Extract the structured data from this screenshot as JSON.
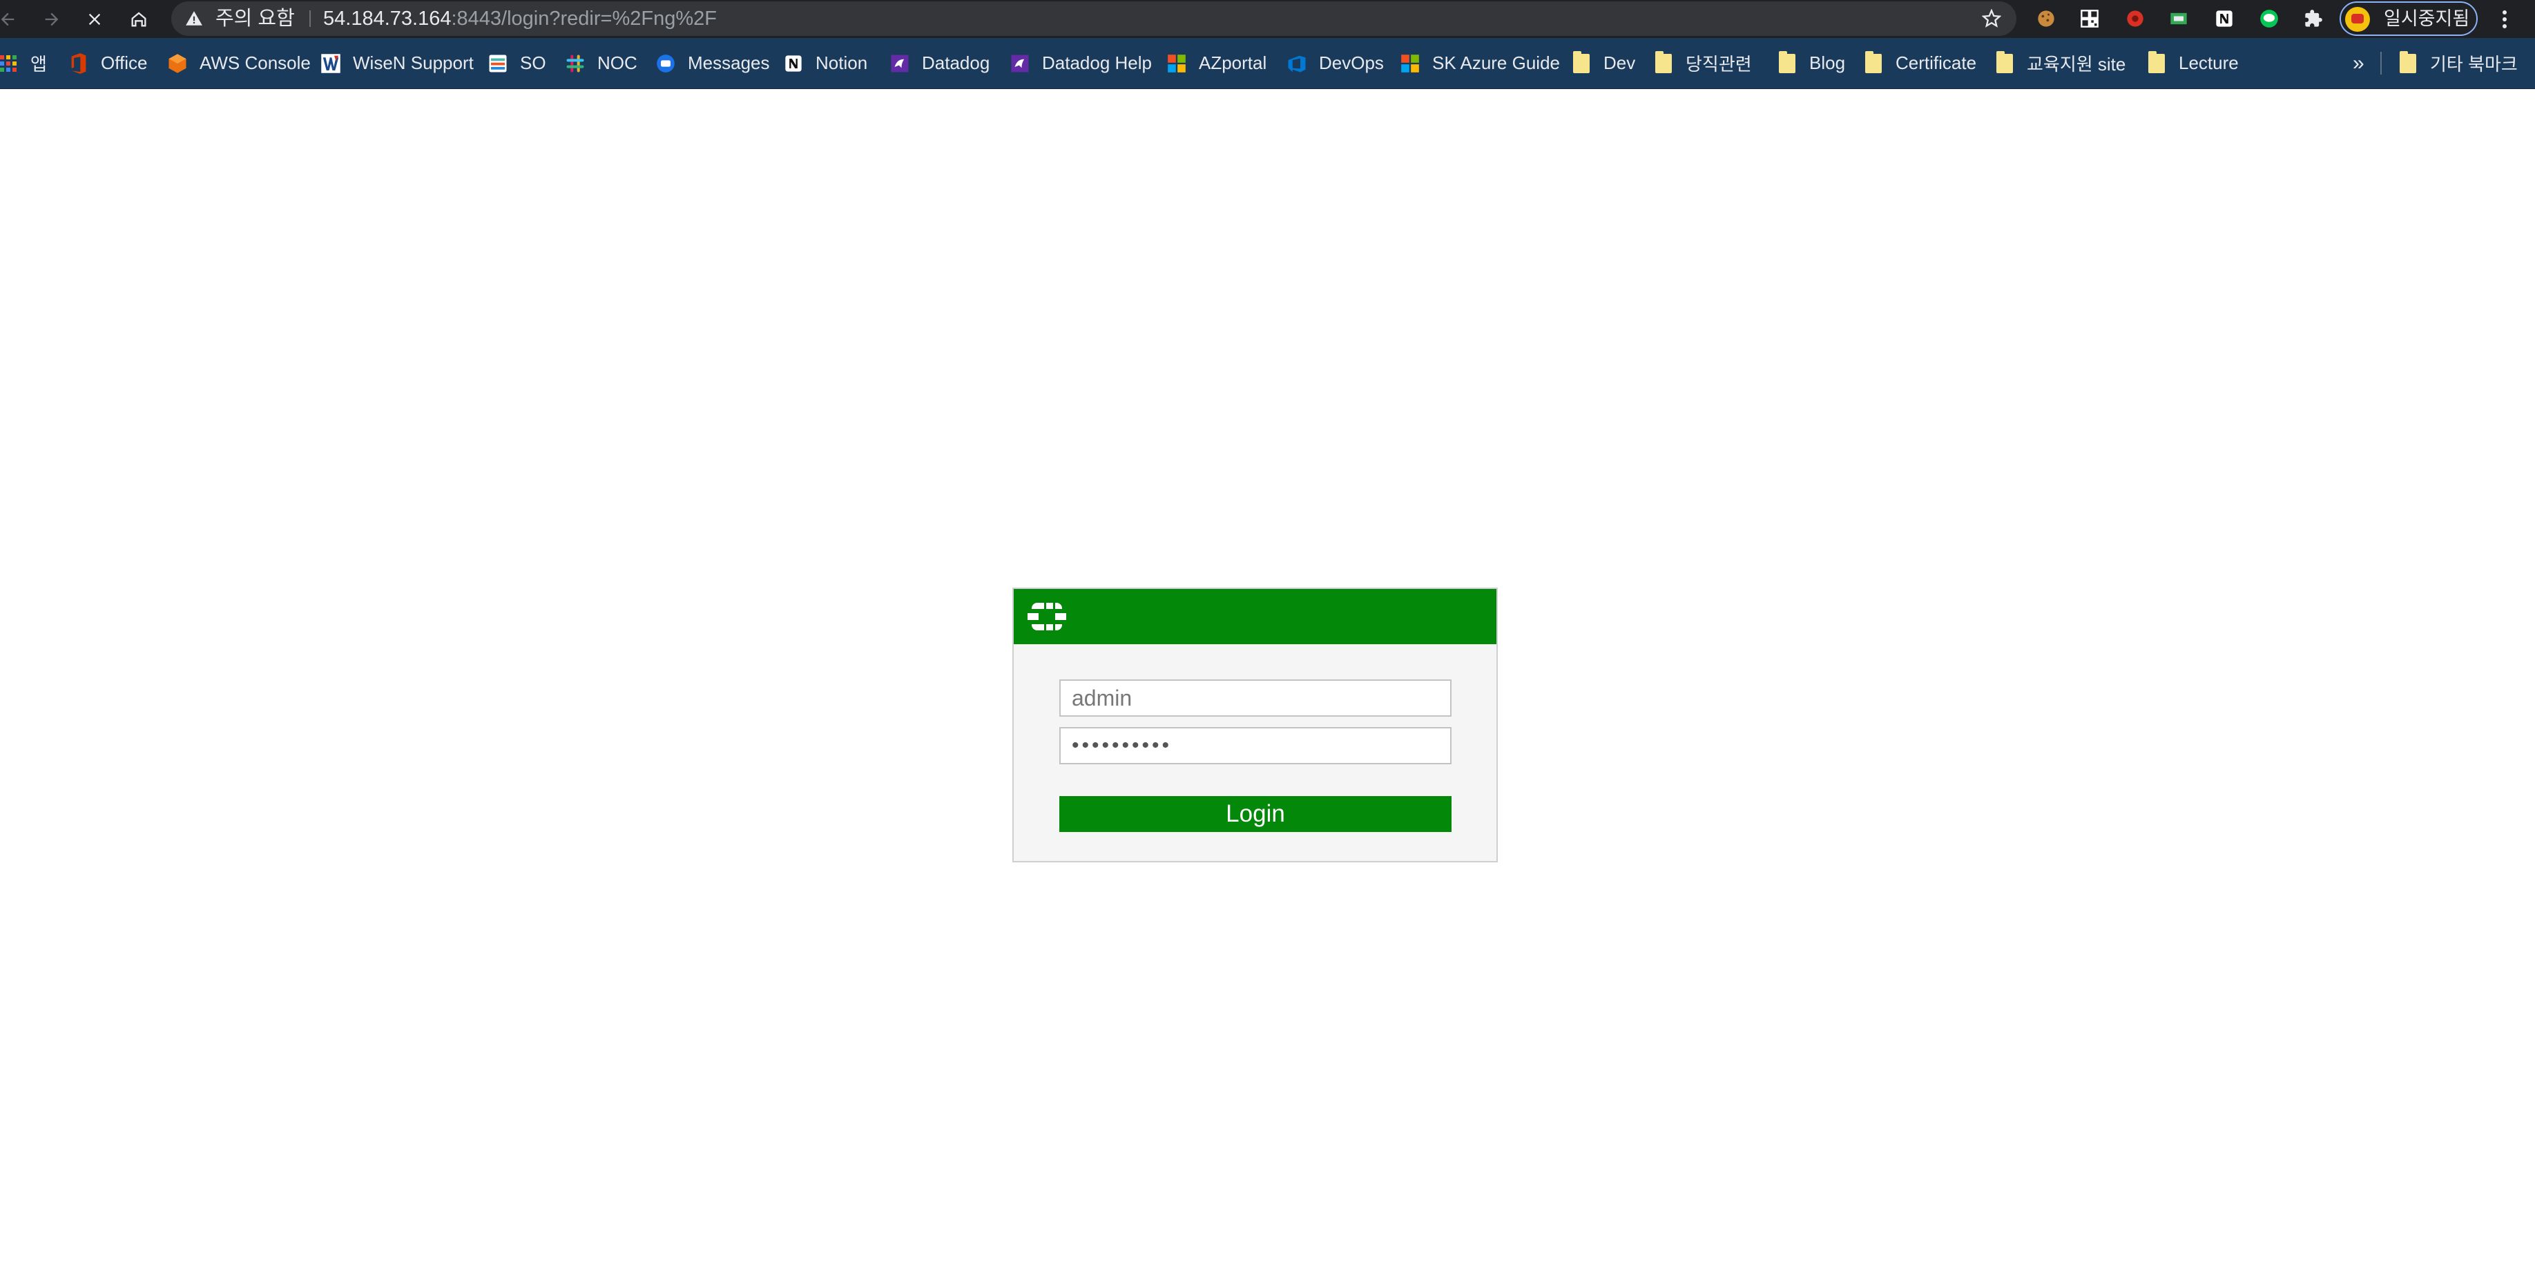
{
  "browser": {
    "security_warning": "주의 요함",
    "url_host": "54.184.73.164",
    "url_rest": ":8443/login?redir=%2Fng%2F",
    "profile_label": "일시중지됨"
  },
  "bookmarks": {
    "apps_label": "앱",
    "items": [
      {
        "label": "Office",
        "icon": "office-icon"
      },
      {
        "label": "AWS Console",
        "icon": "aws-icon"
      },
      {
        "label": "WiseN Support",
        "icon": "wisen-icon"
      },
      {
        "label": "SO",
        "icon": "so-icon"
      },
      {
        "label": "NOC",
        "icon": "slack-icon"
      },
      {
        "label": "Messages",
        "icon": "messages-icon"
      },
      {
        "label": "Notion",
        "icon": "notion-icon"
      },
      {
        "label": "Datadog",
        "icon": "datadog-icon"
      },
      {
        "label": "Datadog Help",
        "icon": "datadog-icon"
      },
      {
        "label": "AZportal",
        "icon": "microsoft-icon"
      },
      {
        "label": "DevOps",
        "icon": "azure-devops-icon"
      },
      {
        "label": "SK Azure Guide",
        "icon": "microsoft-icon"
      },
      {
        "label": "Dev",
        "icon": "folder-icon"
      },
      {
        "label": "당직관련",
        "icon": "folder-icon"
      },
      {
        "label": "Blog",
        "icon": "folder-icon"
      },
      {
        "label": "Certificate",
        "icon": "folder-icon"
      },
      {
        "label": "교육지원 site",
        "icon": "folder-icon"
      },
      {
        "label": "Lecture",
        "icon": "folder-icon"
      }
    ],
    "more": "»",
    "other_bookmarks": "기타 북마크"
  },
  "login": {
    "username_value": "admin",
    "password_mask": "••••••••••",
    "login_button": "Login"
  },
  "colors": {
    "accent_green": "#04880a",
    "chrome_dark": "#202124",
    "bookmarks_bg": "#1a3a5c"
  }
}
